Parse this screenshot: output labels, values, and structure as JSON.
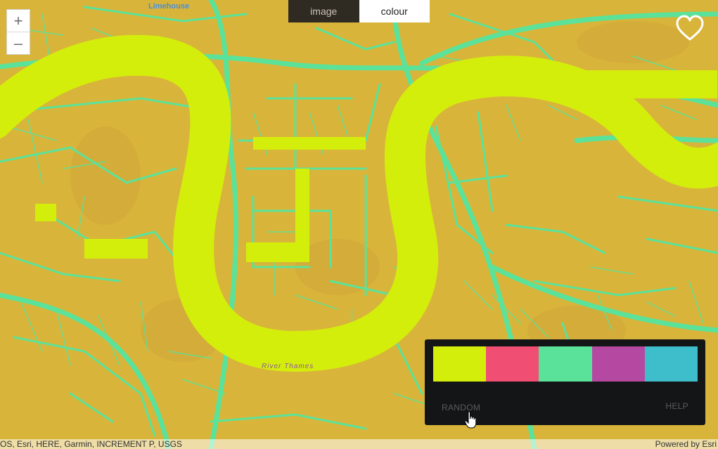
{
  "map": {
    "labels": {
      "district": "Limehouse",
      "river": "River Thames"
    },
    "colors": {
      "land": "#d9b43a",
      "water": "#d4ee0c",
      "roads": "#5be29a"
    }
  },
  "zoom": {
    "in_icon": "+",
    "out_icon": "–"
  },
  "mode_toggle": {
    "image_label": "image",
    "colour_label": "colour",
    "active": "colour"
  },
  "favorite": {
    "icon": "heart-outline-icon"
  },
  "palette": {
    "swatches": [
      "#d4ee0c",
      "#f04e72",
      "#5be29a",
      "#b548a0",
      "#3ebdca"
    ],
    "random_label": "RANDOM",
    "help_label": "HELP"
  },
  "attribution": {
    "sources": "OS, Esri, HERE, Garmin, INCREMENT P, USGS",
    "powered_by": "Powered by Esri"
  }
}
